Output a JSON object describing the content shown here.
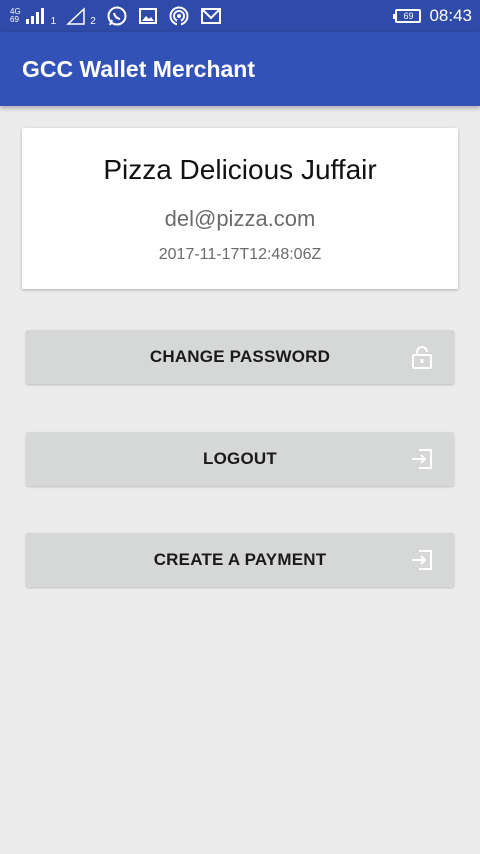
{
  "status_bar": {
    "network_type": "4G",
    "network_sub": "69",
    "sim1_index": "1",
    "sim2_index": "2",
    "battery_level": "69",
    "time": "08:43"
  },
  "app_bar": {
    "title": "GCC Wallet Merchant"
  },
  "profile": {
    "name": "Pizza Delicious Juffair",
    "email": "del@pizza.com",
    "timestamp": "2017-11-17T12:48:06Z"
  },
  "actions": {
    "change_password": "CHANGE PASSWORD",
    "logout": "LOGOUT",
    "create_payment": "CREATE A PAYMENT"
  },
  "icons": {
    "change_password": "lock-icon",
    "logout": "exit-icon",
    "create_payment": "exit-icon"
  },
  "colors": {
    "app_bar": "#3352b8",
    "status_bar": "#2f4aa8",
    "background": "#ececec",
    "button": "#d6d7d7"
  }
}
